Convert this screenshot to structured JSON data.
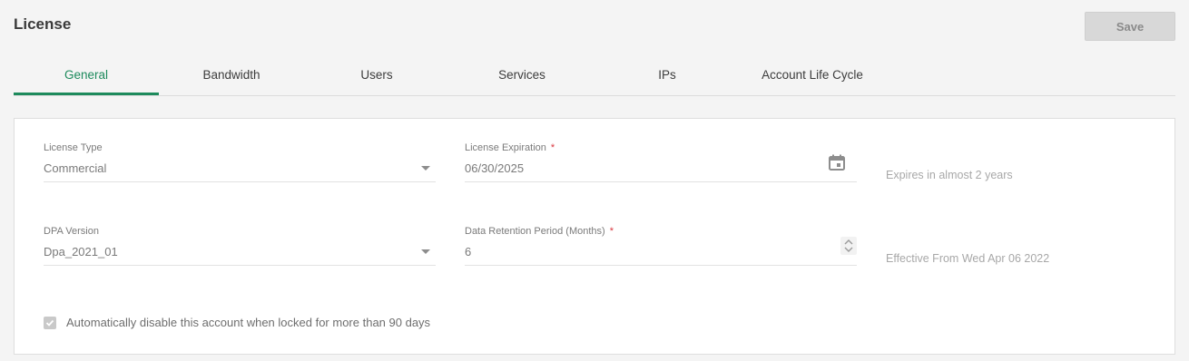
{
  "header": {
    "title": "License",
    "save_label": "Save"
  },
  "tabs": [
    {
      "label": "General",
      "active": true
    },
    {
      "label": "Bandwidth",
      "active": false
    },
    {
      "label": "Users",
      "active": false
    },
    {
      "label": "Services",
      "active": false
    },
    {
      "label": "IPs",
      "active": false
    },
    {
      "label": "Account Life Cycle",
      "active": false
    }
  ],
  "form": {
    "license_type": {
      "label": "License Type",
      "value": "Commercial"
    },
    "license_expiration": {
      "label": "License Expiration",
      "required_mark": "*",
      "value": "06/30/2025",
      "hint": "Expires in almost 2 years"
    },
    "dpa_version": {
      "label": "DPA Version",
      "value": "Dpa_2021_01"
    },
    "data_retention": {
      "label": "Data Retention Period (Months)",
      "required_mark": "*",
      "value": "6",
      "hint": "Effective From Wed Apr 06 2022"
    },
    "auto_disable": {
      "label": "Automatically disable this account when locked for more than 90 days",
      "checked": true
    }
  },
  "colors": {
    "accent": "#1d8a5c",
    "required": "#d9363e"
  }
}
